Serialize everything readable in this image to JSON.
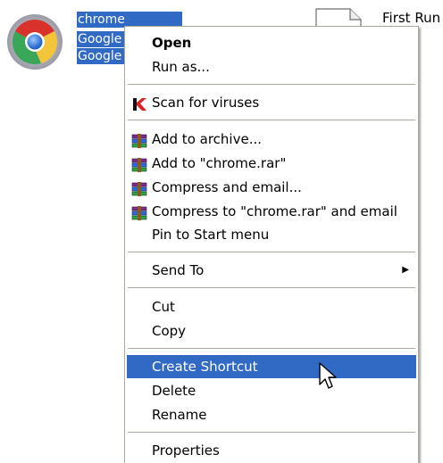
{
  "desktop": {
    "chrome_file": {
      "lines": [
        "chrome",
        "Google",
        "Google"
      ]
    },
    "first_run_file": {
      "label": "First Run"
    }
  },
  "menu": {
    "items": [
      {
        "label": "Open"
      },
      {
        "label": "Run as..."
      },
      {
        "label": "Scan for viruses",
        "icon": "kaspersky-icon"
      },
      {
        "label": "Add to archive...",
        "icon": "winrar-icon"
      },
      {
        "label": "Add to \"chrome.rar\"",
        "icon": "winrar-icon"
      },
      {
        "label": "Compress and email...",
        "icon": "winrar-icon"
      },
      {
        "label": "Compress to \"chrome.rar\" and email",
        "icon": "winrar-icon"
      },
      {
        "label": "Pin to Start menu"
      },
      {
        "label": "Send To",
        "submenu_icon": "submenu-arrow-icon"
      },
      {
        "label": "Cut"
      },
      {
        "label": "Copy"
      },
      {
        "label": "Create Shortcut",
        "highlighted": true
      },
      {
        "label": "Delete"
      },
      {
        "label": "Rename"
      },
      {
        "label": "Properties"
      }
    ],
    "highlight_color": "#316ac5",
    "separator_color": "#aca899"
  }
}
